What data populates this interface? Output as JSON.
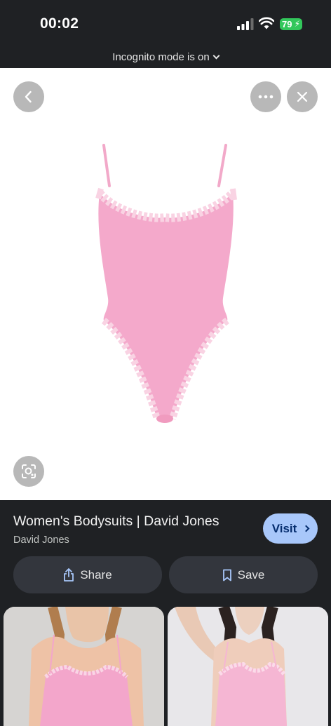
{
  "status_bar": {
    "time": "00:02",
    "battery": "79",
    "battery_color": "#32c75b"
  },
  "incognito_banner": {
    "label": "Incognito mode is on"
  },
  "viewer": {
    "back_icon": "chevron-left-icon",
    "more_icon": "more-horizontal-icon",
    "close_icon": "close-icon",
    "lens_icon": "lens-search-icon",
    "product_image": "pink lace-trim bodysuit"
  },
  "result": {
    "title": "Women's Bodysuits | David Jones",
    "source": "David Jones",
    "visit_label": "Visit",
    "share_label": "Share",
    "save_label": "Save",
    "accent": "#a8c7fa"
  },
  "related": {
    "items": [
      {
        "image": "model in pink lace cami bodysuit, front"
      },
      {
        "image": "model in pink lace cami bodysuit, arm raised"
      }
    ]
  }
}
